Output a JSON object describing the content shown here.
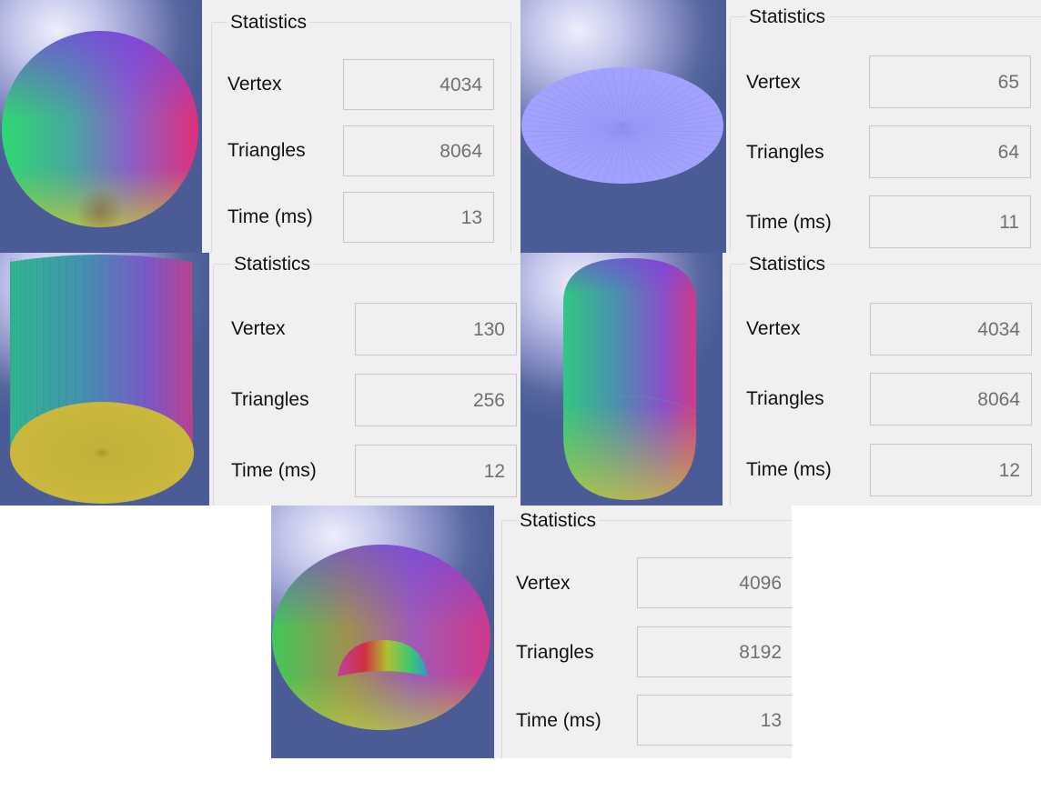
{
  "panels": [
    {
      "shape": "sphere",
      "group_title": "Statistics",
      "vertex_label": "Vertex",
      "vertex_value": "4034",
      "triangles_label": "Triangles",
      "triangles_value": "8064",
      "time_label": "Time (ms)",
      "time_value": "13"
    },
    {
      "shape": "disk",
      "group_title": "Statistics",
      "vertex_label": "Vertex",
      "vertex_value": "65",
      "triangles_label": "Triangles",
      "triangles_value": "64",
      "time_label": "Time (ms)",
      "time_value": "11"
    },
    {
      "shape": "cylinder",
      "group_title": "Statistics",
      "vertex_label": "Vertex",
      "vertex_value": "130",
      "triangles_label": "Triangles",
      "triangles_value": "256",
      "time_label": "Time (ms)",
      "time_value": "12"
    },
    {
      "shape": "capsule",
      "group_title": "Statistics",
      "vertex_label": "Vertex",
      "vertex_value": "4034",
      "triangles_label": "Triangles",
      "triangles_value": "8064",
      "time_label": "Time (ms)",
      "time_value": "12"
    },
    {
      "shape": "torus",
      "group_title": "Statistics",
      "vertex_label": "Vertex",
      "vertex_value": "4096",
      "triangles_label": "Triangles",
      "triangles_value": "8192",
      "time_label": "Time (ms)",
      "time_value": "13"
    }
  ],
  "colors": {
    "viewport_light": "#eeeefc",
    "viewport_dark": "#4a5b96",
    "disk_fill": "#a1a1fd",
    "cylinder_cap": "#c8b63a"
  }
}
